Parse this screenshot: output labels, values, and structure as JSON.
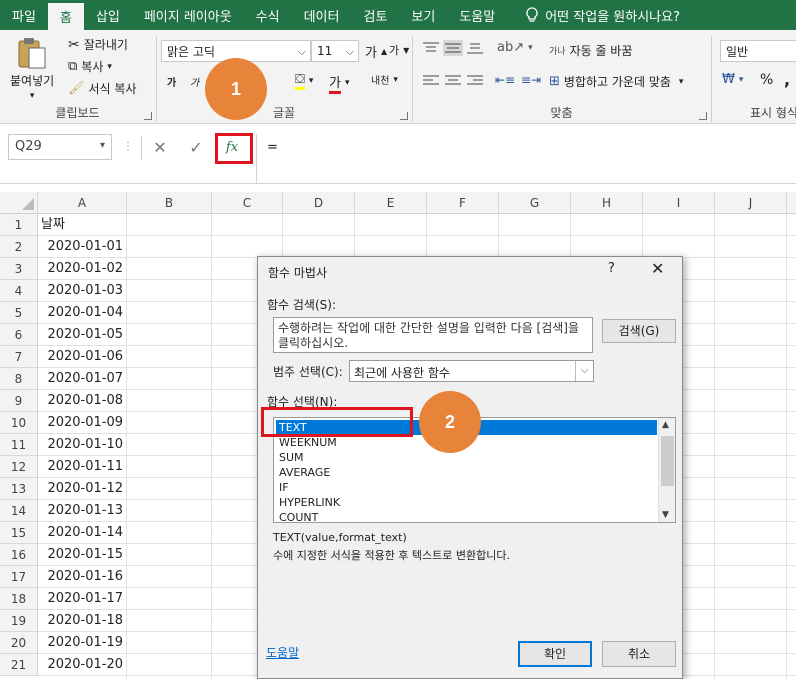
{
  "tabs": [
    "파일",
    "홈",
    "삽입",
    "페이지 레이아웃",
    "수식",
    "데이터",
    "검토",
    "보기",
    "도움말"
  ],
  "tell_me": "어떤 작업을 원하시나요?",
  "ribbon": {
    "paste": "붙여넣기",
    "cut": "잘라내기",
    "copy": "복사",
    "format_painter": "서식 복사",
    "clipboard_label": "클립보드",
    "font_name": "맑은 고딕",
    "font_size": "11",
    "font_label": "글꼴",
    "wrap_text": "자동 줄 바꿈",
    "merge_center": "병합하고 가운데 맞춤",
    "align_label": "맞춤",
    "number_format": "일반",
    "number_label": "표시 형식",
    "bold": "가",
    "italic": "가",
    "font_color_glyph": "가",
    "increase_font_glyph": "가",
    "decrease_font_glyph": "가",
    "phonetic_glyph": "내천",
    "wrap_glyph": "가나",
    "percent": "%",
    "comma": ","
  },
  "formula_bar": {
    "name_box": "Q29",
    "fx": "fx",
    "content": "="
  },
  "grid": {
    "columns": [
      "A",
      "B",
      "C",
      "D",
      "E",
      "F",
      "G",
      "H",
      "I",
      "J"
    ],
    "rows": [
      {
        "n": "1",
        "a": "날짜"
      },
      {
        "n": "2",
        "a": "2020-01-01"
      },
      {
        "n": "3",
        "a": "2020-01-02"
      },
      {
        "n": "4",
        "a": "2020-01-03"
      },
      {
        "n": "5",
        "a": "2020-01-04"
      },
      {
        "n": "6",
        "a": "2020-01-05"
      },
      {
        "n": "7",
        "a": "2020-01-06"
      },
      {
        "n": "8",
        "a": "2020-01-07"
      },
      {
        "n": "9",
        "a": "2020-01-08"
      },
      {
        "n": "10",
        "a": "2020-01-09"
      },
      {
        "n": "11",
        "a": "2020-01-10"
      },
      {
        "n": "12",
        "a": "2020-01-11"
      },
      {
        "n": "13",
        "a": "2020-01-12"
      },
      {
        "n": "14",
        "a": "2020-01-13"
      },
      {
        "n": "15",
        "a": "2020-01-14"
      },
      {
        "n": "16",
        "a": "2020-01-15"
      },
      {
        "n": "17",
        "a": "2020-01-16"
      },
      {
        "n": "18",
        "a": "2020-01-17"
      },
      {
        "n": "19",
        "a": "2020-01-18"
      },
      {
        "n": "20",
        "a": "2020-01-19"
      },
      {
        "n": "21",
        "a": "2020-01-20"
      }
    ]
  },
  "dialog": {
    "title": "함수 마법사",
    "help": "?",
    "close": "✕",
    "search_label": "함수 검색(S):",
    "search_text": "수행하려는 작업에 대한 간단한 설명을 입력한 다음 [검색]을 클릭하십시오.",
    "search_button": "검색(G)",
    "category_label": "범주 선택(C):",
    "category_value": "최근에 사용한 함수",
    "select_label": "함수 선택(N):",
    "functions": [
      "TEXT",
      "WEEKNUM",
      "SUM",
      "AVERAGE",
      "IF",
      "HYPERLINK",
      "COUNT"
    ],
    "signature": "TEXT(value,format_text)",
    "description": "수에 지정한 서식을 적용한 후 텍스트로 변환합니다.",
    "help_link": "도움말",
    "ok": "확인",
    "cancel": "취소"
  },
  "badges": [
    "1",
    "2"
  ],
  "colors": {
    "excel_green": "#217346",
    "highlight_red": "#e0141e",
    "badge_orange": "#e8833a",
    "selection_blue": "#0078d7"
  }
}
